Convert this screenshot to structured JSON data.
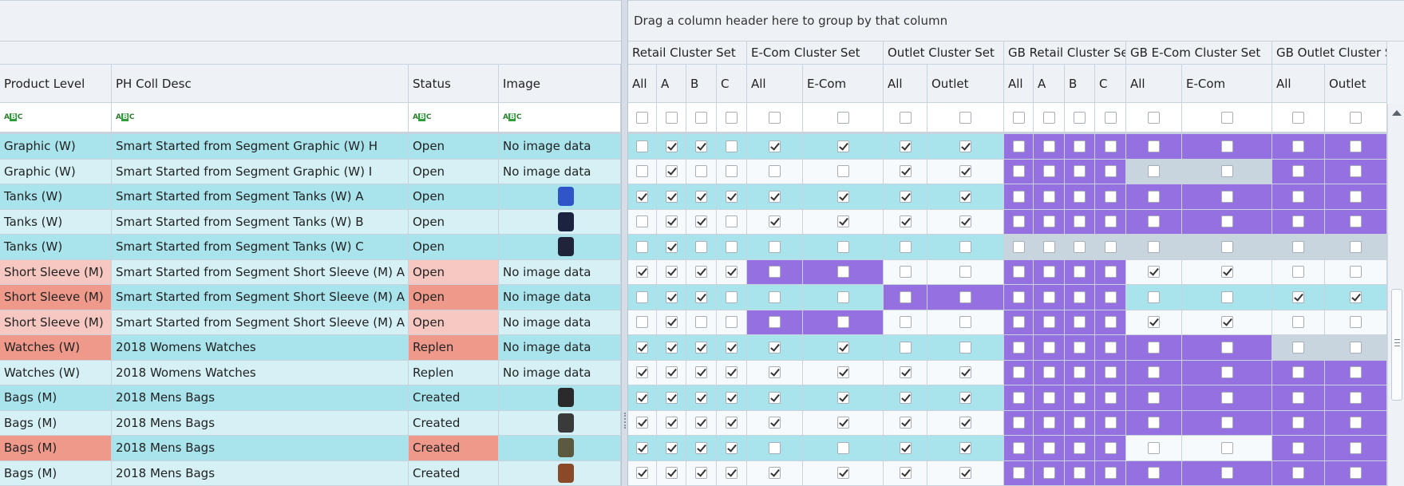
{
  "group_panel": {
    "text": "Drag a column header here to group by that column"
  },
  "left_columns": [
    "Product Level",
    "PH Coll Desc",
    "Status",
    "Image"
  ],
  "filter_icon": "abc-text-filter-icon",
  "bands": [
    "Retail Cluster Set",
    "E-Com Cluster Set",
    "Outlet Cluster Set",
    "GB Retail Cluster Set",
    "GB E-Com Cluster Set",
    "GB Outlet Cluster Set"
  ],
  "sub_columns": [
    "All",
    "A",
    "B",
    "C",
    "All",
    "E-Com",
    "All",
    "Outlet",
    "All",
    "A",
    "B",
    "C",
    "All",
    "E-Com",
    "All",
    "Outlet"
  ],
  "colors": {
    "row_dark": "#a9e3ec",
    "row_light": "#d5f1f6",
    "salmon": "#ef998b",
    "salmon_light": "#f6c8c1",
    "purple": "#9470e0",
    "grey": "#c8d4de",
    "white_cell": "#f6fafc"
  },
  "rows": [
    {
      "level": "Graphic (W)",
      "desc": "Smart Started from Segment Graphic (W) H",
      "status": "Open",
      "image": "No image data",
      "thumb": null,
      "bg": "d",
      "lvl_bg": null,
      "st_bg": null,
      "checks": [
        0,
        1,
        1,
        0,
        1,
        1,
        1,
        1,
        0,
        0,
        0,
        0,
        0,
        0,
        0,
        0
      ],
      "cbg": [
        "",
        "",
        "",
        "",
        "",
        "",
        "",
        "",
        "p",
        "p",
        "p",
        "p",
        "p",
        "p",
        "p",
        "p"
      ]
    },
    {
      "level": "Graphic (W)",
      "desc": "Smart Started from Segment Graphic (W) I",
      "status": "Open",
      "image": "No image data",
      "thumb": null,
      "bg": "l",
      "lvl_bg": null,
      "st_bg": null,
      "checks": [
        0,
        1,
        0,
        0,
        0,
        0,
        1,
        1,
        0,
        0,
        0,
        0,
        0,
        0,
        0,
        0
      ],
      "cbg": [
        "w",
        "w",
        "w",
        "w",
        "w",
        "w",
        "w",
        "w",
        "p",
        "p",
        "p",
        "p",
        "g",
        "g",
        "p",
        "p"
      ]
    },
    {
      "level": "Tanks (W)",
      "desc": "Smart Started from Segment Tanks (W) A",
      "status": "Open",
      "image": "",
      "thumb": "tank-blue",
      "bg": "d",
      "lvl_bg": null,
      "st_bg": null,
      "checks": [
        1,
        1,
        1,
        1,
        1,
        1,
        1,
        1,
        0,
        0,
        0,
        0,
        0,
        0,
        0,
        0
      ],
      "cbg": [
        "",
        "",
        "",
        "",
        "",
        "",
        "",
        "",
        "p",
        "p",
        "p",
        "p",
        "p",
        "p",
        "p",
        "p"
      ]
    },
    {
      "level": "Tanks (W)",
      "desc": "Smart Started from Segment Tanks (W) B",
      "status": "Open",
      "image": "",
      "thumb": "tank-navy",
      "bg": "l",
      "lvl_bg": null,
      "st_bg": null,
      "checks": [
        0,
        1,
        1,
        0,
        1,
        1,
        1,
        1,
        0,
        0,
        0,
        0,
        0,
        0,
        0,
        0
      ],
      "cbg": [
        "w",
        "w",
        "w",
        "w",
        "w",
        "w",
        "w",
        "w",
        "p",
        "p",
        "p",
        "p",
        "p",
        "p",
        "p",
        "p"
      ]
    },
    {
      "level": "Tanks (W)",
      "desc": "Smart Started from Segment Tanks (W) C",
      "status": "Open",
      "image": "",
      "thumb": "tank-dark",
      "bg": "d",
      "lvl_bg": null,
      "st_bg": null,
      "checks": [
        0,
        1,
        0,
        0,
        0,
        0,
        0,
        0,
        0,
        0,
        0,
        0,
        0,
        0,
        0,
        0
      ],
      "cbg": [
        "",
        "",
        "",
        "",
        "",
        "",
        "",
        "",
        "g",
        "g",
        "g",
        "g",
        "g",
        "g",
        "g",
        "g"
      ]
    },
    {
      "level": "Short Sleeve (M)",
      "desc": "Smart Started from Segment Short Sleeve (M) A",
      "status": "Open",
      "image": "No image data",
      "thumb": null,
      "bg": "l",
      "lvl_bg": "sl",
      "st_bg": "sl",
      "checks": [
        1,
        1,
        1,
        1,
        0,
        0,
        0,
        0,
        0,
        0,
        0,
        0,
        1,
        1,
        0,
        0
      ],
      "cbg": [
        "w",
        "w",
        "w",
        "w",
        "p",
        "p",
        "w",
        "w",
        "p",
        "p",
        "p",
        "p",
        "w",
        "w",
        "w",
        "w"
      ]
    },
    {
      "level": "Short Sleeve (M)",
      "desc": "Smart Started from Segment Short Sleeve (M) A",
      "status": "Open",
      "image": "No image data",
      "thumb": null,
      "bg": "d",
      "lvl_bg": "s",
      "st_bg": "s",
      "checks": [
        0,
        1,
        1,
        0,
        0,
        0,
        0,
        0,
        0,
        0,
        0,
        0,
        0,
        0,
        1,
        1
      ],
      "cbg": [
        "",
        "",
        "",
        "",
        "",
        "",
        "p",
        "p",
        "p",
        "p",
        "p",
        "p",
        "",
        "",
        "",
        ""
      ]
    },
    {
      "level": "Short Sleeve (M)",
      "desc": "Smart Started from Segment Short Sleeve (M) A",
      "status": "Open",
      "image": "No image data",
      "thumb": null,
      "bg": "l",
      "lvl_bg": "sl",
      "st_bg": "sl",
      "checks": [
        0,
        1,
        0,
        0,
        0,
        0,
        0,
        0,
        0,
        0,
        0,
        0,
        1,
        1,
        0,
        0
      ],
      "cbg": [
        "w",
        "w",
        "w",
        "w",
        "p",
        "p",
        "w",
        "w",
        "p",
        "p",
        "p",
        "p",
        "w",
        "w",
        "w",
        "w"
      ]
    },
    {
      "level": "Watches (W)",
      "desc": "2018 Womens Watches",
      "status": "Replen",
      "image": "No image data",
      "thumb": null,
      "bg": "d",
      "lvl_bg": "s",
      "st_bg": "s",
      "checks": [
        1,
        1,
        1,
        1,
        1,
        1,
        0,
        0,
        0,
        0,
        0,
        0,
        0,
        0,
        0,
        0
      ],
      "cbg": [
        "",
        "",
        "",
        "",
        "",
        "",
        "",
        "",
        "p",
        "p",
        "p",
        "p",
        "p",
        "p",
        "g",
        "g"
      ]
    },
    {
      "level": "Watches (W)",
      "desc": "2018 Womens Watches",
      "status": "Replen",
      "image": "No image data",
      "thumb": null,
      "bg": "l",
      "lvl_bg": null,
      "st_bg": null,
      "checks": [
        1,
        1,
        1,
        1,
        1,
        1,
        1,
        1,
        0,
        0,
        0,
        0,
        0,
        0,
        0,
        0
      ],
      "cbg": [
        "w",
        "w",
        "w",
        "w",
        "w",
        "w",
        "w",
        "w",
        "p",
        "p",
        "p",
        "p",
        "p",
        "p",
        "p",
        "p"
      ]
    },
    {
      "level": "Bags (M)",
      "desc": "2018 Mens Bags",
      "status": "Created",
      "image": "",
      "thumb": "bag-black",
      "bg": "d",
      "lvl_bg": null,
      "st_bg": null,
      "checks": [
        1,
        1,
        1,
        1,
        1,
        1,
        1,
        1,
        0,
        0,
        0,
        0,
        0,
        0,
        0,
        0
      ],
      "cbg": [
        "",
        "",
        "",
        "",
        "",
        "",
        "",
        "",
        "p",
        "p",
        "p",
        "p",
        "p",
        "p",
        "p",
        "p"
      ]
    },
    {
      "level": "Bags (M)",
      "desc": "2018 Mens Bags",
      "status": "Created",
      "image": "",
      "thumb": "bag-backpack",
      "bg": "l",
      "lvl_bg": null,
      "st_bg": null,
      "checks": [
        1,
        1,
        1,
        1,
        1,
        1,
        1,
        1,
        0,
        0,
        0,
        0,
        0,
        0,
        0,
        0
      ],
      "cbg": [
        "w",
        "w",
        "w",
        "w",
        "w",
        "w",
        "w",
        "w",
        "p",
        "p",
        "p",
        "p",
        "p",
        "p",
        "p",
        "p"
      ]
    },
    {
      "level": "Bags (M)",
      "desc": "2018 Mens Bags",
      "status": "Created",
      "image": "",
      "thumb": "bag-olive",
      "bg": "d",
      "lvl_bg": "s",
      "st_bg": "s",
      "checks": [
        1,
        1,
        1,
        1,
        0,
        0,
        1,
        1,
        0,
        0,
        0,
        0,
        0,
        0,
        0,
        0
      ],
      "cbg": [
        "",
        "",
        "",
        "",
        "",
        "",
        "",
        "",
        "p",
        "p",
        "p",
        "p",
        "w",
        "w",
        "p",
        "p"
      ]
    },
    {
      "level": "Bags (M)",
      "desc": "2018 Mens Bags",
      "status": "Created",
      "image": "",
      "thumb": "bag-brown",
      "bg": "l",
      "lvl_bg": null,
      "st_bg": null,
      "checks": [
        1,
        1,
        1,
        1,
        1,
        1,
        1,
        1,
        0,
        0,
        0,
        0,
        0,
        0,
        0,
        0
      ],
      "cbg": [
        "w",
        "w",
        "w",
        "w",
        "w",
        "w",
        "w",
        "w",
        "p",
        "p",
        "p",
        "p",
        "p",
        "p",
        "p",
        "p"
      ]
    }
  ],
  "thumb_colors": {
    "tank-blue": "#2f55c8",
    "tank-navy": "#1c2340",
    "tank-dark": "#20243a",
    "bag-black": "#2a2a2a",
    "bag-backpack": "#3a3a3a",
    "bag-olive": "#5b5a3e",
    "bag-brown": "#8a4a2a"
  }
}
